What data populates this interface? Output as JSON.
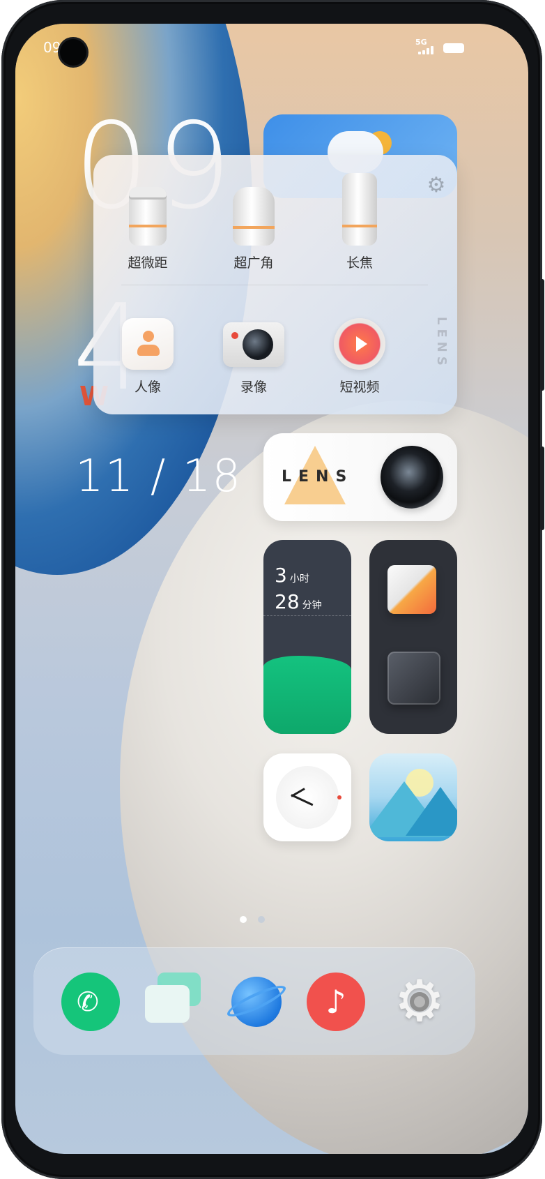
{
  "status_bar": {
    "time": "09",
    "network": "5G"
  },
  "clock_widget": {
    "hours": "09",
    "minutes": "4",
    "weekday": "W",
    "date": "11 / 18",
    "accent_color": "#e2553a"
  },
  "lens_panel": {
    "settings_icon": "gear-icon",
    "vertical_label": "LENS",
    "lenses": [
      {
        "label": "超微距",
        "icon": "macro-lens-icon"
      },
      {
        "label": "超广角",
        "icon": "wide-angle-lens-icon"
      },
      {
        "label": "长焦",
        "icon": "telephoto-lens-icon"
      }
    ],
    "modes": [
      {
        "label": "人像",
        "icon": "portrait-mode-icon"
      },
      {
        "label": "录像",
        "icon": "video-mode-icon"
      },
      {
        "label": "短视频",
        "icon": "short-video-icon"
      }
    ]
  },
  "lens_widget": {
    "title": "LENS"
  },
  "screen_time_widget": {
    "hours_value": "3",
    "hours_unit": "小时",
    "minutes_value": "28",
    "minutes_unit": "分钟",
    "accent_color": "#14c27f"
  },
  "page_dots": {
    "active_index": 0,
    "count": 2,
    "active_color": "#ffffff",
    "inactive_color": "#c7cfd9"
  },
  "dock": {
    "apps": [
      {
        "name": "phone",
        "icon": "phone-icon"
      },
      {
        "name": "messages",
        "icon": "messages-icon"
      },
      {
        "name": "browser",
        "icon": "browser-icon"
      },
      {
        "name": "music",
        "icon": "music-icon"
      },
      {
        "name": "settings",
        "icon": "settings-icon"
      }
    ]
  }
}
